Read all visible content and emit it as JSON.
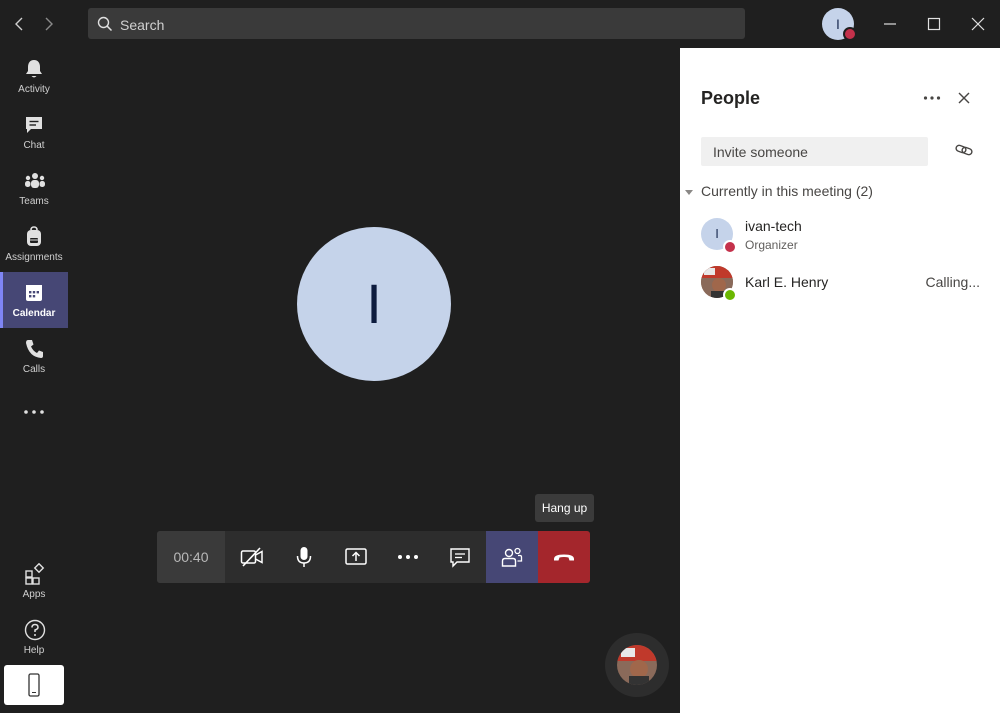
{
  "search": {
    "placeholder": "Search"
  },
  "account": {
    "initial": "I"
  },
  "rail": {
    "items": [
      {
        "label": "Activity"
      },
      {
        "label": "Chat"
      },
      {
        "label": "Teams"
      },
      {
        "label": "Assignments"
      },
      {
        "label": "Calendar"
      },
      {
        "label": "Calls"
      }
    ],
    "apps": "Apps",
    "help": "Help"
  },
  "call": {
    "participant_initial": "I",
    "timer": "00:40",
    "tooltip": "Hang up"
  },
  "people_panel": {
    "title": "People",
    "invite_placeholder": "Invite someone",
    "section_label": "Currently in this meeting",
    "section_count": "(2)",
    "participants": [
      {
        "initial": "I",
        "name": "ivan-tech",
        "role": "Organizer",
        "status": ""
      },
      {
        "initial": "",
        "name": "Karl E. Henry",
        "role": "",
        "status": "Calling..."
      }
    ]
  },
  "colors": {
    "accent": "#464775",
    "hangup": "#a4262c",
    "busy": "#c4314b",
    "available": "#6bb700"
  }
}
